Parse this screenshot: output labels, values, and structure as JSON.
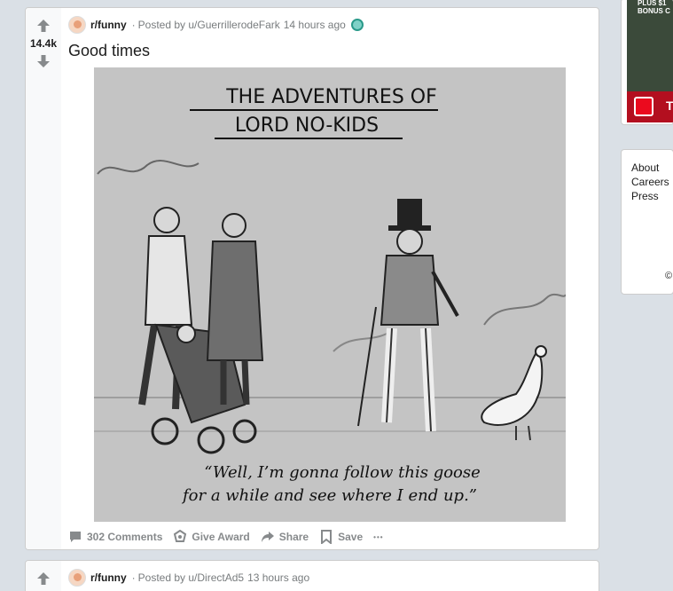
{
  "posts": [
    {
      "score": "14.4k",
      "subreddit": "r/funny",
      "posted_by": "Posted by u/GuerrillerodeFark",
      "time": "14 hours ago",
      "title": "Good times",
      "comic": {
        "heading_line1": "THE ADVENTURES OF",
        "heading_line2": "LORD NO-KIDS",
        "caption_line1": "“Well, I’m gonna follow this goose",
        "caption_line2": "for a while and see where I end up.”"
      },
      "actions": {
        "comments": "302 Comments",
        "give_award": "Give Award",
        "share": "Share",
        "save": "Save",
        "more": "•••"
      }
    },
    {
      "subreddit": "r/funny",
      "posted_by": "Posted by u/DirectAd5",
      "time": "13 hours ago"
    }
  ],
  "sidebar": {
    "ad_text": "PLUS $1\nBONUS C",
    "ad_brand_letter": "T",
    "footer_links": [
      "About",
      "Careers",
      "Press"
    ],
    "footer_copy": "©"
  },
  "icons": {
    "upvote": "upvote-arrow-icon",
    "downvote": "downvote-arrow-icon",
    "comment": "comment-bubble-icon",
    "award": "award-icon",
    "share": "share-arrow-icon",
    "save": "bookmark-icon",
    "more": "more-dots-icon"
  },
  "colors": {
    "page_bg": "#dae0e6",
    "card_bg": "#ffffff",
    "vote_bg": "#f8f9fa",
    "muted_text": "#787c7e",
    "ad_red": "#eb0a1e"
  }
}
